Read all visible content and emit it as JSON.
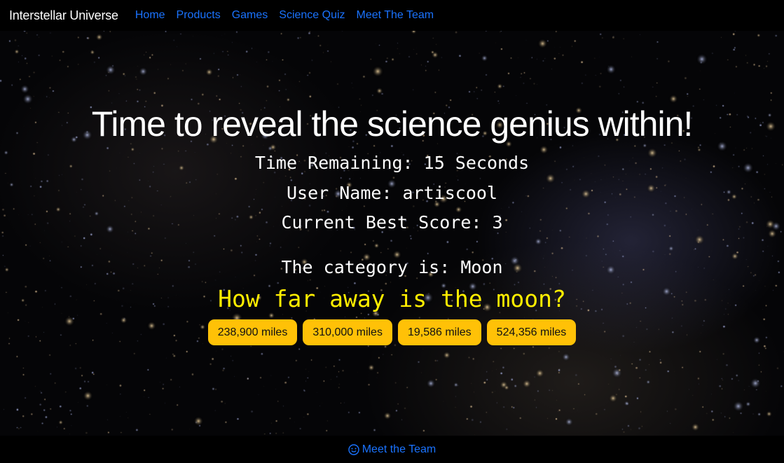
{
  "navbar": {
    "brand": "Interstellar Universe",
    "links": [
      "Home",
      "Products",
      "Games",
      "Science Quiz",
      "Meet The Team"
    ]
  },
  "quiz": {
    "headline": "Time to reveal the science genius within!",
    "time_remaining": "Time Remaining: 15 Seconds",
    "user_name": "User Name: artiscool",
    "best_score": "Current Best Score: 3",
    "category": "The category is: Moon",
    "question": "How far away is the moon?",
    "answers": [
      "238,900 miles",
      "310,000 miles",
      "19,586 miles",
      "524,356 miles"
    ]
  },
  "footer": {
    "link_icon": "smile-icon",
    "link_label": "Meet the Team"
  },
  "colors": {
    "link": "#1a73ff",
    "question": "#ffee00",
    "answer_button": "#ffc107",
    "background": "#000000"
  }
}
